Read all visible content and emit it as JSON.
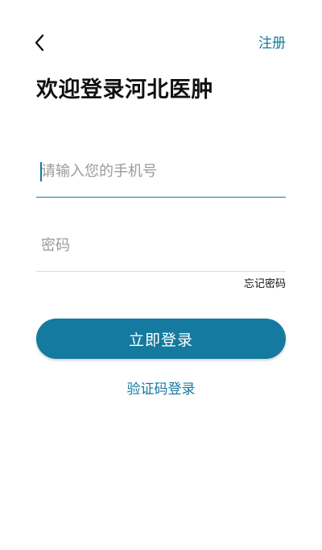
{
  "header": {
    "back_icon": "chevron-left-icon",
    "register_label": "注册"
  },
  "title": "欢迎登录河北医肿",
  "form": {
    "phone": {
      "value": "",
      "placeholder": "请输入您的手机号"
    },
    "password": {
      "value": "",
      "placeholder": "密码"
    },
    "forgot_password_label": "忘记密码",
    "login_button_label": "立即登录",
    "sms_login_label": "验证码登录"
  },
  "colors": {
    "accent": "#157a9f",
    "text": "#111111",
    "placeholder": "#9a9a9a",
    "divider": "#dcdcdc",
    "background": "#ffffff"
  }
}
